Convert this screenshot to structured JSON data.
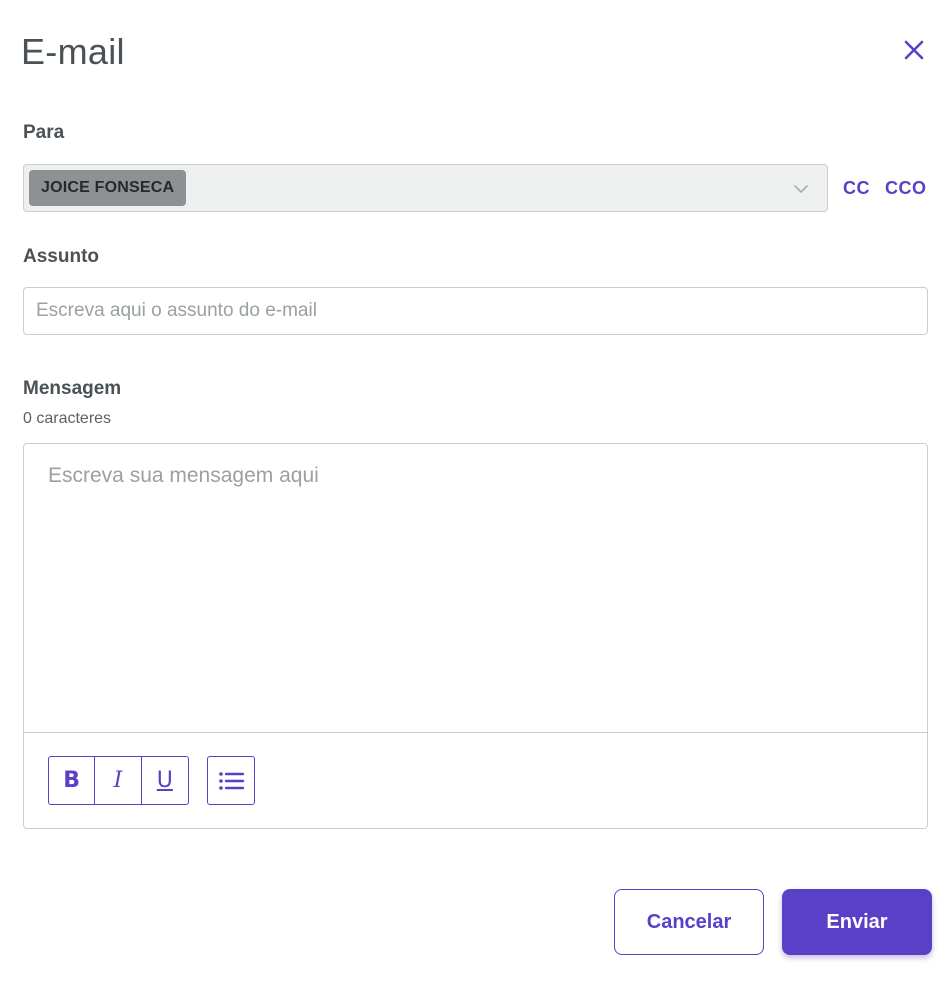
{
  "modal": {
    "title": "E-mail"
  },
  "to": {
    "label": "Para",
    "recipients": [
      "JOICE FONSECA"
    ],
    "cc_label": "CC",
    "cco_label": "CCO"
  },
  "subject": {
    "label": "Assunto",
    "value": "",
    "placeholder": "Escreva aqui o assunto do e-mail"
  },
  "message": {
    "label": "Mensagem",
    "char_count": "0 caracteres",
    "value": "",
    "placeholder": "Escreva sua mensagem aqui"
  },
  "toolbar": {
    "bold": "B",
    "italic": "I",
    "underline": "U"
  },
  "actions": {
    "cancel_label": "Cancelar",
    "send_label": "Enviar"
  },
  "colors": {
    "accent": "#5a3fc7",
    "text": "#4a5256",
    "chip": "#8d9193"
  },
  "icons": {
    "close": "close-icon",
    "dropdown": "chevron-down-icon",
    "list": "bullet-list-icon"
  }
}
